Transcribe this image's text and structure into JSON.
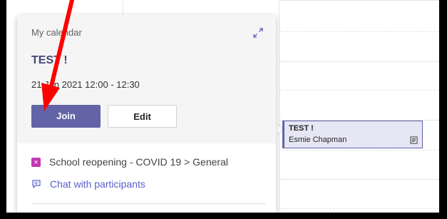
{
  "popup": {
    "calendar_name": "My calendar",
    "event_title": "TEST !",
    "event_time": "21 Jan 2021 12:00 - 12:30",
    "join_label": "Join",
    "edit_label": "Edit",
    "channel_label": "School reopening - COVID 19 > General",
    "chat_label": "Chat with participants"
  },
  "event_block": {
    "title": "TEST !",
    "organizer": "Esmie Chapman"
  },
  "colors": {
    "accent": "#6264a7",
    "team_icon": "#c239b3",
    "annotation": "#ff0000"
  },
  "icons": {
    "expand": "expand-icon",
    "team": "team-icon",
    "chat": "chat-icon",
    "event_details": "event-details-icon"
  }
}
